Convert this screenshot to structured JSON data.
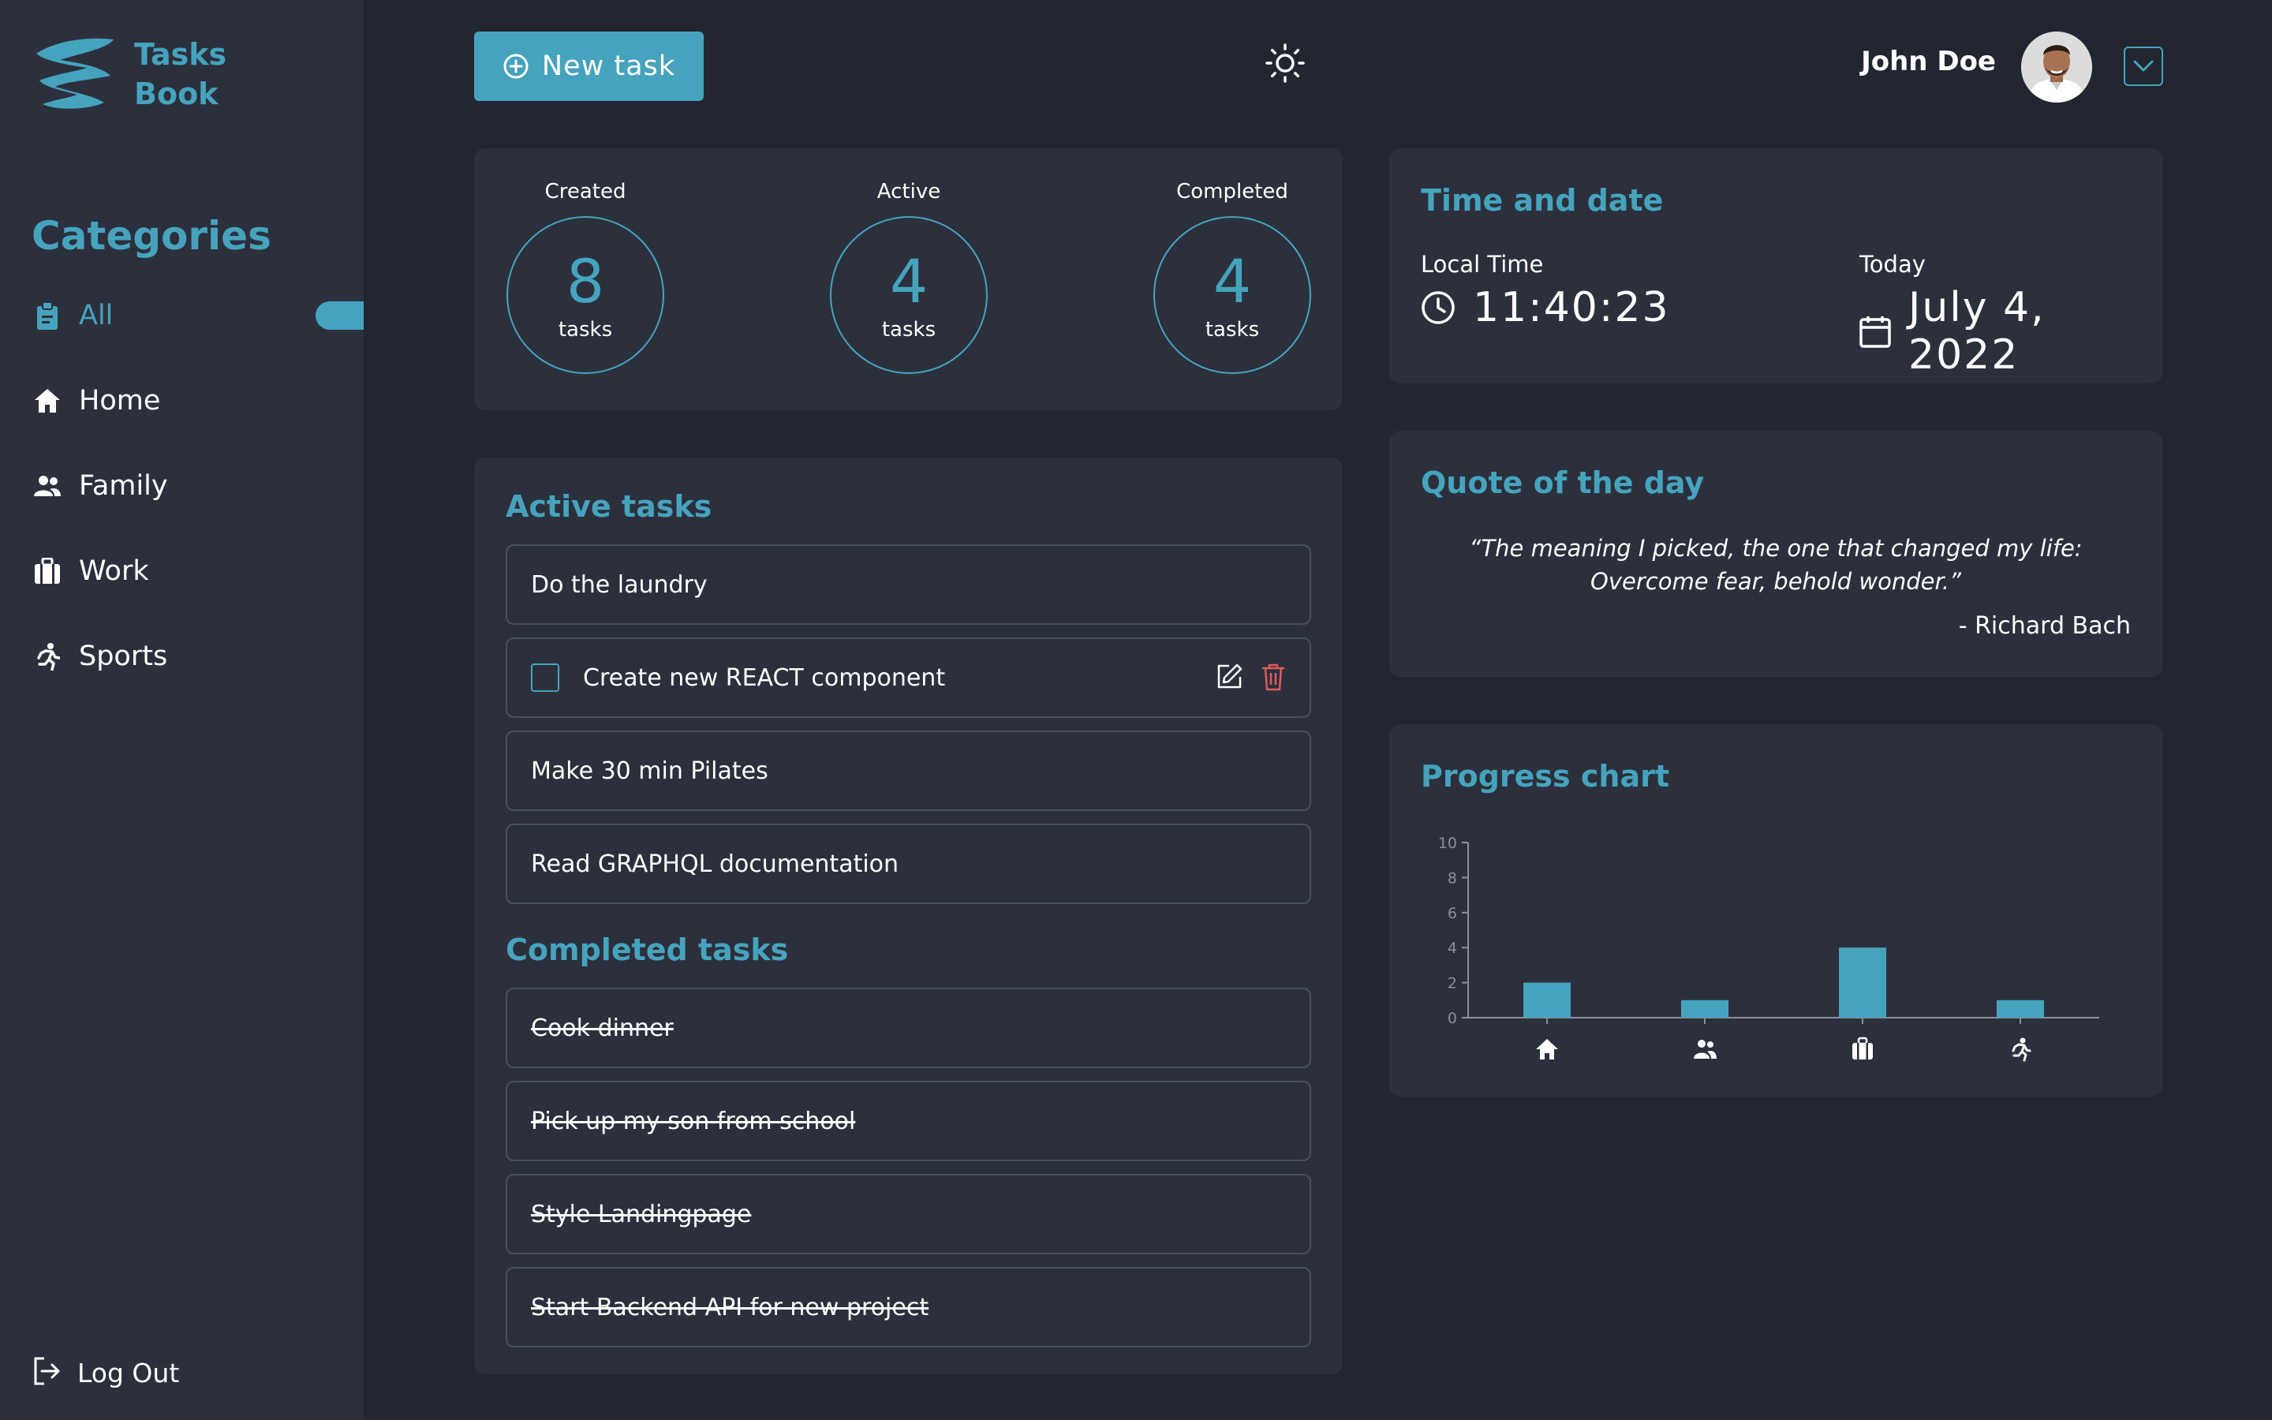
{
  "app": {
    "logo_line1": "Tasks",
    "logo_line2": "Book"
  },
  "sidebar": {
    "title": "Categories",
    "items": [
      {
        "label": "All",
        "icon": "clipboard-icon",
        "active": true
      },
      {
        "label": "Home",
        "icon": "home-icon",
        "active": false
      },
      {
        "label": "Family",
        "icon": "family-icon",
        "active": false
      },
      {
        "label": "Work",
        "icon": "briefcase-icon",
        "active": false
      },
      {
        "label": "Sports",
        "icon": "running-icon",
        "active": false
      }
    ],
    "logout_label": "Log Out"
  },
  "header": {
    "new_task_label": "New task",
    "user_name": "John Doe"
  },
  "stats": [
    {
      "label": "Created",
      "value": "8",
      "unit": "tasks"
    },
    {
      "label": "Active",
      "value": "4",
      "unit": "tasks"
    },
    {
      "label": "Completed",
      "value": "4",
      "unit": "tasks"
    }
  ],
  "active_tasks": {
    "title": "Active tasks",
    "items": [
      "Do the laundry",
      "Create new REACT component",
      "Make 30 min Pilates",
      "Read GRAPHQL documentation"
    ]
  },
  "completed_tasks": {
    "title": "Completed tasks",
    "items": [
      "Cook dinner",
      "Pick up my son from school",
      "Style Landingpage",
      "Start Backend API for new project"
    ]
  },
  "time_date": {
    "title": "Time and date",
    "local_time_label": "Local Time",
    "local_time": "11:40:23",
    "today_label": "Today",
    "today": "July 4, 2022"
  },
  "quote": {
    "title": "Quote of the day",
    "text": "“The meaning I picked, the one that changed my life: Overcome fear, behold wonder.”",
    "author": "- Richard Bach"
  },
  "progress": {
    "title": "Progress chart"
  },
  "colors": {
    "accent": "#46a3bd",
    "background": "#222631",
    "card": "#2c303d",
    "danger": "#e05a5a"
  },
  "chart_data": {
    "type": "bar",
    "categories": [
      "home-icon",
      "family-icon",
      "briefcase-icon",
      "running-icon"
    ],
    "values": [
      2,
      1,
      4,
      1
    ],
    "ylim": [
      0,
      10
    ],
    "yticks": [
      0,
      2,
      4,
      6,
      8,
      10
    ],
    "grid": false
  }
}
